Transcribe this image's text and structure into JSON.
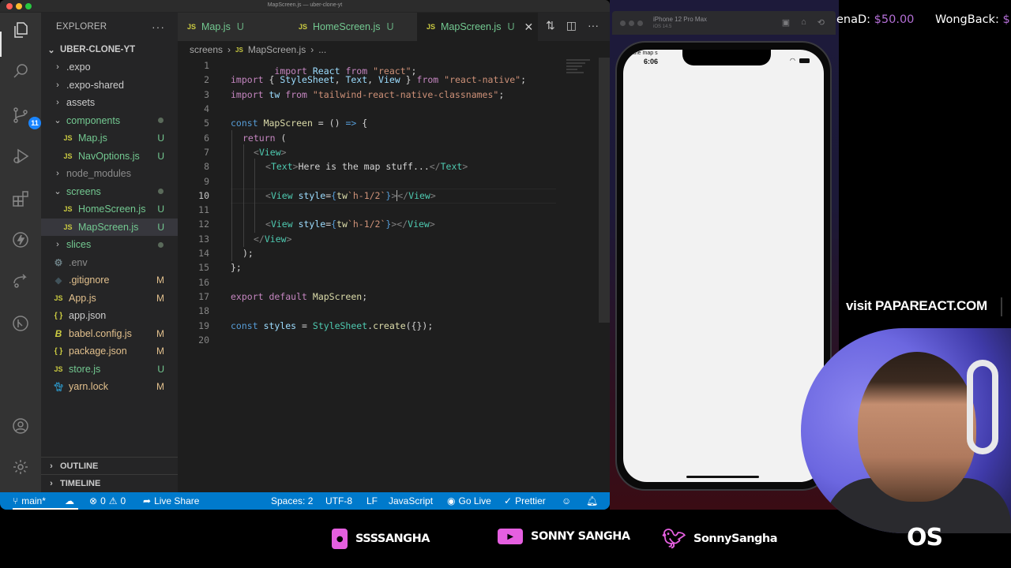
{
  "window": {
    "title": "MapScreen.js — uber-clone-yt"
  },
  "activity_bar": {
    "items": [
      {
        "name": "explorer",
        "icon": "files-icon",
        "active": true
      },
      {
        "name": "search",
        "icon": "search-icon"
      },
      {
        "name": "source-control",
        "icon": "source-control-icon",
        "badge": "11"
      },
      {
        "name": "run-debug",
        "icon": "run-debug-icon"
      },
      {
        "name": "extensions",
        "icon": "extensions-icon"
      },
      {
        "name": "lightning",
        "icon": "lightning-icon"
      },
      {
        "name": "live-share",
        "icon": "live-share-icon"
      },
      {
        "name": "gitlens",
        "icon": "gitlens-icon"
      }
    ],
    "bottom": [
      {
        "name": "accounts",
        "icon": "account-icon"
      },
      {
        "name": "manage",
        "icon": "gear-icon"
      }
    ]
  },
  "sidebar": {
    "title": "EXPLORER",
    "more": "···",
    "root": "UBER-CLONE-YT",
    "tree": [
      {
        "label": ".expo",
        "type": "folder",
        "expanded": false,
        "status": ""
      },
      {
        "label": ".expo-shared",
        "type": "folder",
        "expanded": false,
        "status": ""
      },
      {
        "label": "assets",
        "type": "folder",
        "expanded": false,
        "status": ""
      },
      {
        "label": "components",
        "type": "folder",
        "expanded": true,
        "status": "dot"
      },
      {
        "label": "Map.js",
        "type": "js",
        "status": "U"
      },
      {
        "label": "NavOptions.js",
        "type": "js",
        "status": "U"
      },
      {
        "label": "node_modules",
        "type": "folder",
        "expanded": false,
        "status": ""
      },
      {
        "label": "screens",
        "type": "folder",
        "expanded": true,
        "status": "dot"
      },
      {
        "label": "HomeScreen.js",
        "type": "js",
        "status": "U"
      },
      {
        "label": "MapScreen.js",
        "type": "js",
        "status": "U",
        "selected": true
      },
      {
        "label": "slices",
        "type": "folder",
        "expanded": false,
        "status": "dot"
      },
      {
        "label": ".env",
        "type": "env",
        "status": ""
      },
      {
        "label": ".gitignore",
        "type": "git",
        "status": "M"
      },
      {
        "label": "App.js",
        "type": "js",
        "status": "M"
      },
      {
        "label": "app.json",
        "type": "json",
        "status": ""
      },
      {
        "label": "babel.config.js",
        "type": "babel",
        "status": "M"
      },
      {
        "label": "package.json",
        "type": "json",
        "status": "M"
      },
      {
        "label": "store.js",
        "type": "js",
        "status": "U"
      },
      {
        "label": "yarn.lock",
        "type": "yarn",
        "status": "M"
      }
    ],
    "sections": [
      "OUTLINE",
      "TIMELINE"
    ]
  },
  "tabs": [
    {
      "label": "Map.js",
      "status": "U",
      "active": false
    },
    {
      "label": "HomeScreen.js",
      "status": "U",
      "active": false
    },
    {
      "label": "MapScreen.js",
      "status": "U",
      "active": true
    }
  ],
  "breadcrumb": {
    "folder": "screens",
    "file": "MapScreen.js",
    "symbol": "..."
  },
  "editor": {
    "current_line": 10,
    "lines": [
      {
        "n": "1"
      },
      {
        "n": "2"
      },
      {
        "n": "3"
      },
      {
        "n": "4"
      },
      {
        "n": "5"
      },
      {
        "n": "6"
      },
      {
        "n": "7"
      },
      {
        "n": "8"
      },
      {
        "n": "9"
      },
      {
        "n": "10"
      },
      {
        "n": "11"
      },
      {
        "n": "12"
      },
      {
        "n": "13"
      },
      {
        "n": "14"
      },
      {
        "n": "15"
      },
      {
        "n": "16"
      },
      {
        "n": "17"
      },
      {
        "n": "18"
      },
      {
        "n": "19"
      },
      {
        "n": "20"
      }
    ],
    "tokens": {
      "import": "import",
      "from": "from",
      "react_id": "React",
      "react_str": "\"react\"",
      "semi": ";",
      "l2_open": "{ ",
      "stylesheet": "StyleSheet",
      "comma": ", ",
      "text": "Text",
      "view": "View",
      "l2_close": " }",
      "rn_str": "\"react-native\"",
      "tw": "tw",
      "tw_str": "\"tailwind-react-native-classnames\"",
      "const": "const",
      "mapscreen": "MapScreen",
      "eq": " = ",
      "parens": "()",
      "arrow": "=>",
      "brace_open": "{",
      "return": "return",
      "paren_open": "(",
      "lt": "<",
      "gt": ">",
      "lt_slash": "</",
      "text_content": "Here is the map stuff...",
      "style": "style",
      "eq_tight": "=",
      "tw_tmpl": "`h-1/2`",
      "brace_close": "}",
      "close_paren_semi": ");",
      "close_brace_semi": "};",
      "export": "export",
      "default": "default",
      "styles": "styles",
      "create": "create",
      "create_args": "({});",
      "dot": "."
    }
  },
  "statusbar": {
    "branch": "main*",
    "errors": "0",
    "warnings": "0",
    "live_share": "Live Share",
    "spaces": "Spaces: 2",
    "encoding": "UTF-8",
    "eol": "LF",
    "language": "JavaScript",
    "go_live": "Go Live",
    "prettier": "Prettier"
  },
  "simulator": {
    "device": "iPhone 12 Pro Max",
    "os": "iOS 14.5",
    "time": "6:06",
    "app_text": "e is the map s"
  },
  "overlay": {
    "tickers": [
      {
        "name": "enaD:",
        "amount": "$50.00"
      },
      {
        "name": "WongBack:",
        "amount": "$"
      }
    ],
    "visit": "visit PAPAREACT.COM",
    "socials": [
      {
        "platform": "instagram",
        "icon": "instagram-icon",
        "handle": "SSSSANGHA"
      },
      {
        "platform": "youtube",
        "icon": "youtube-icon",
        "handle": "SONNY SANGHA"
      },
      {
        "platform": "twitter",
        "icon": "twitter-icon",
        "handle": "SonnySangha"
      }
    ],
    "logo": "OS"
  },
  "colors": {
    "accent": "#007acc",
    "git_untracked": "#73c991",
    "git_modified": "#e2c08d",
    "ticker_amount": "#b46fd6",
    "social_pink": "#e55fe0"
  }
}
